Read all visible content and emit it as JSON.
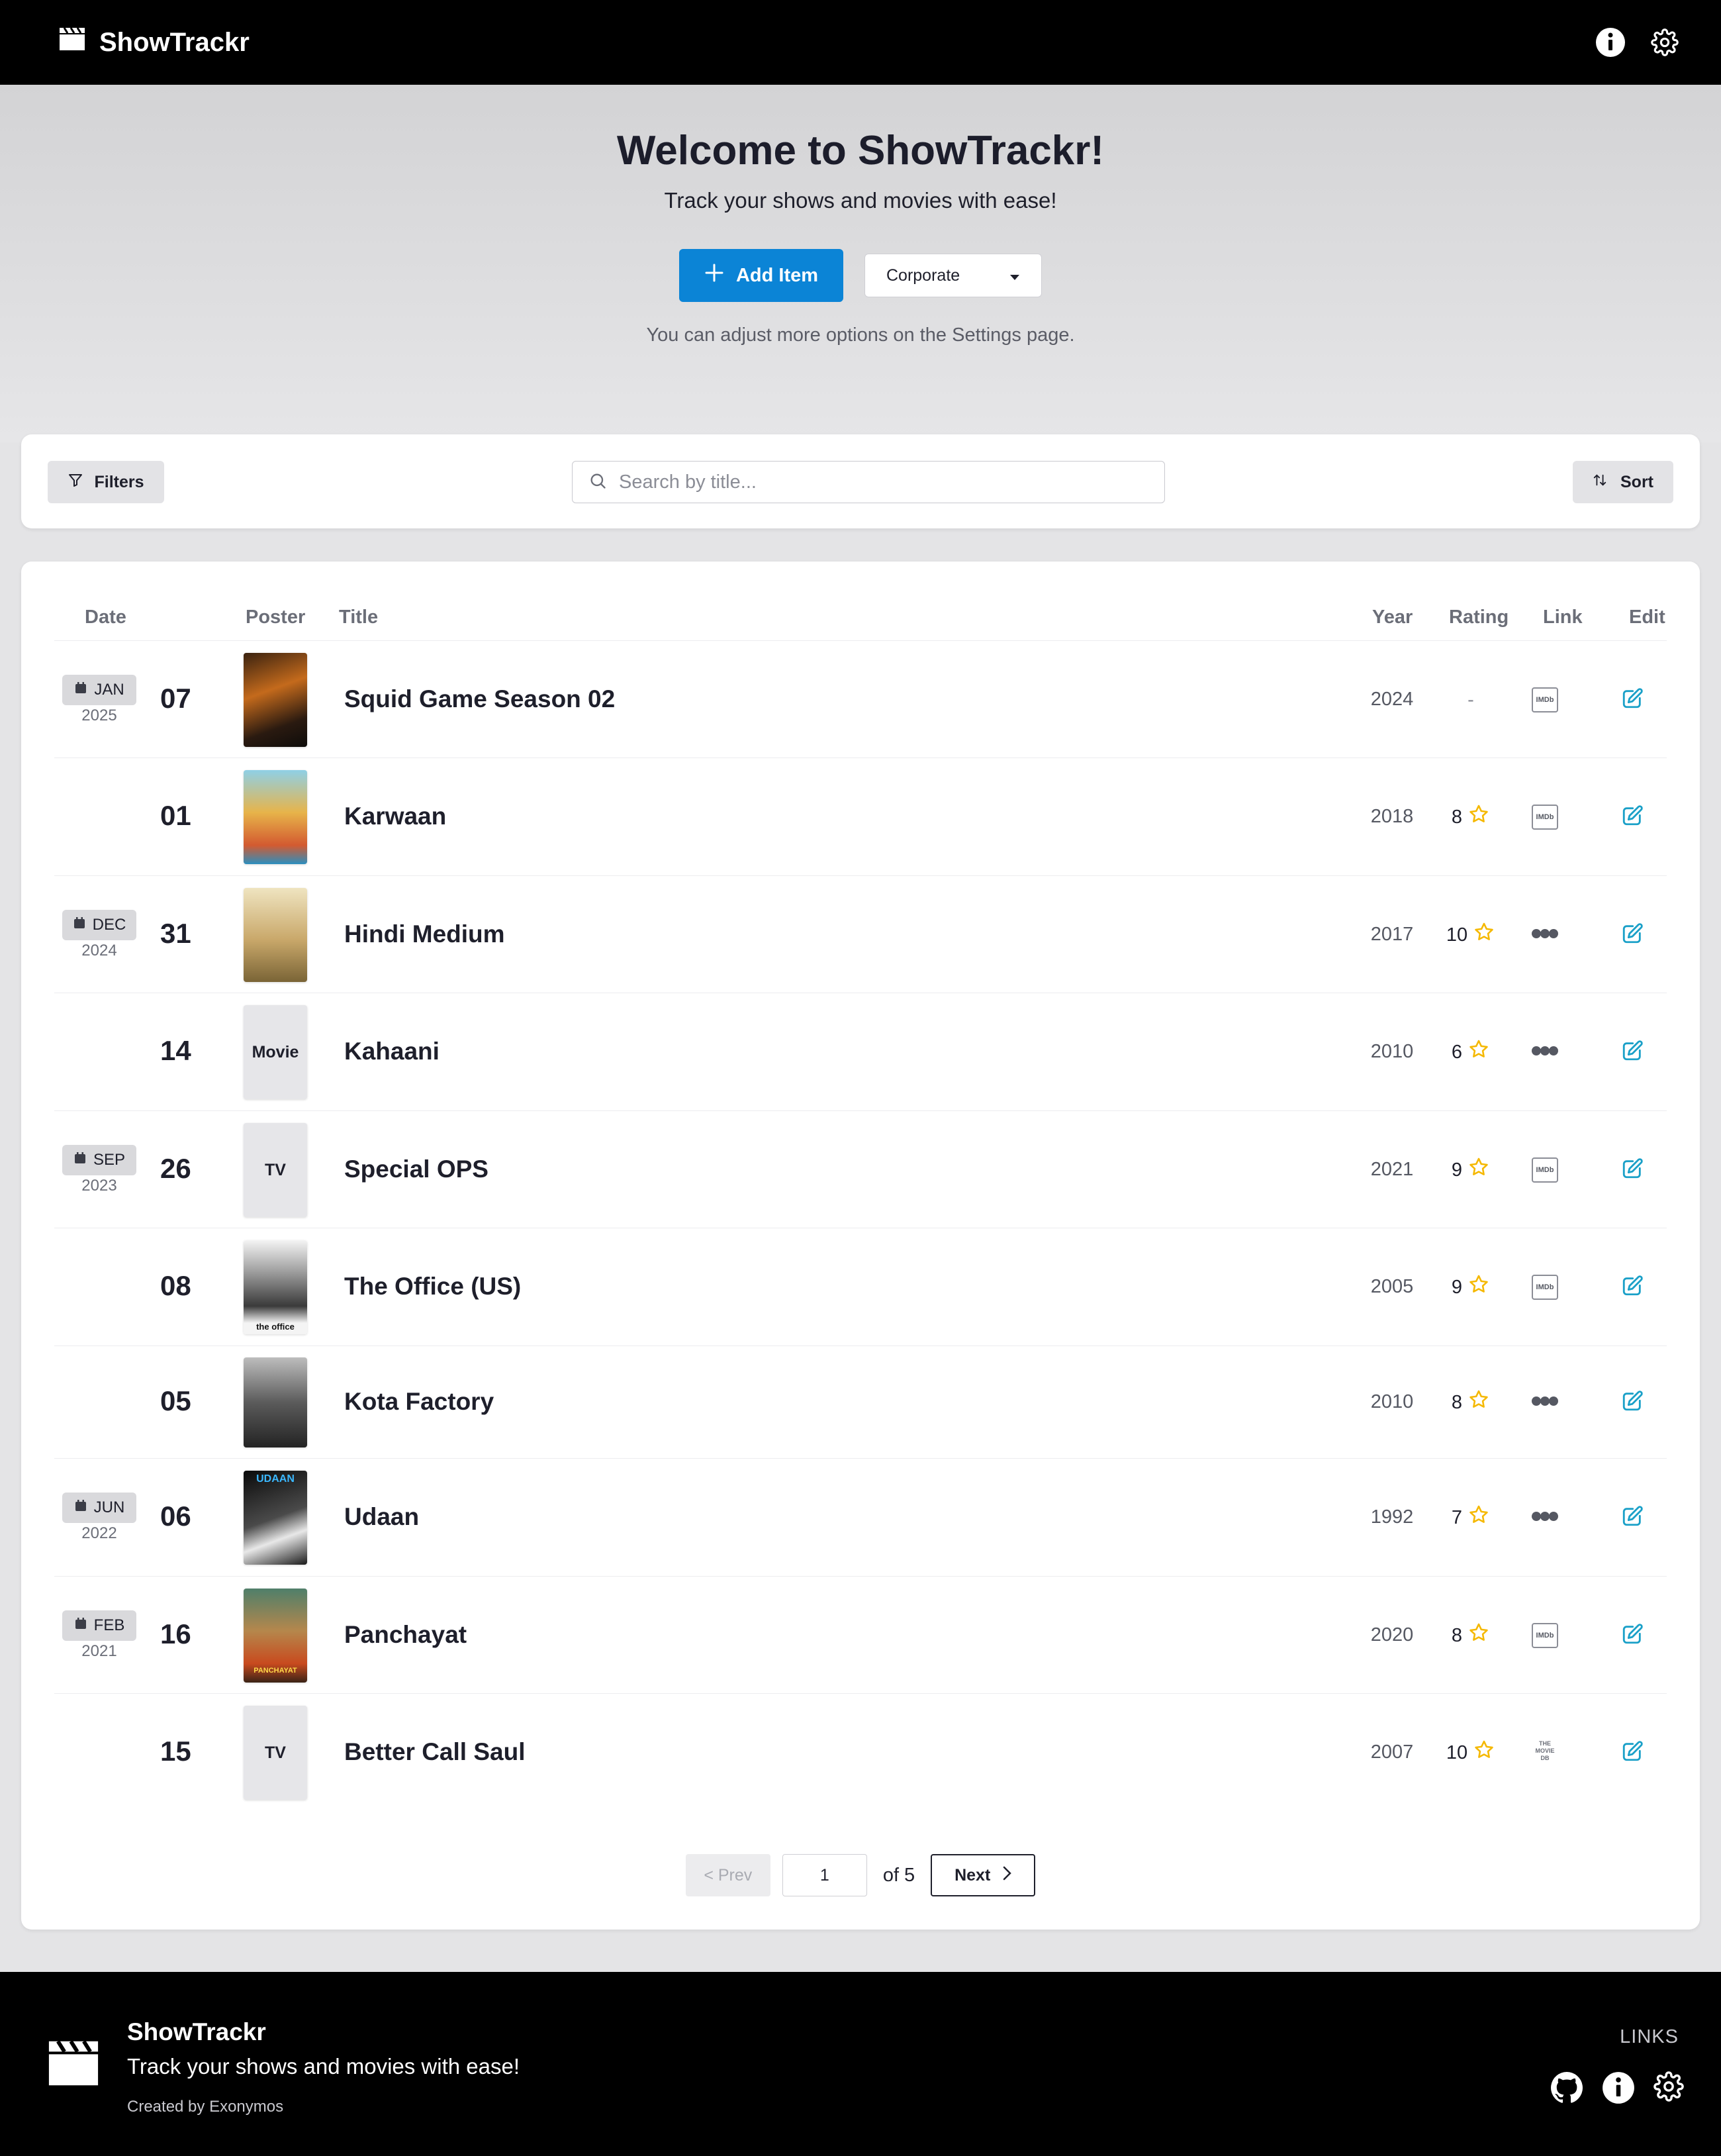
{
  "app": {
    "name": "ShowTrackr"
  },
  "hero": {
    "title": "Welcome to ShowTrackr!",
    "subtitle": "Track your shows and movies with ease!",
    "add_label": "Add Item",
    "theme_value": "Corporate",
    "hint": "You can adjust more options on the Settings page."
  },
  "toolbar": {
    "filters_label": "Filters",
    "search_placeholder": "Search by title...",
    "sort_label": "Sort"
  },
  "table": {
    "headers": {
      "date": "Date",
      "poster": "Poster",
      "title": "Title",
      "year": "Year",
      "rating": "Rating",
      "link": "Link",
      "edit": "Edit"
    },
    "rows": [
      {
        "month": "JAN",
        "date_year": "2025",
        "day": "07",
        "poster_label": "",
        "poster_kind": "squid",
        "title": "Squid Game Season 02",
        "year": "2024",
        "rating": "-",
        "link": "imdb"
      },
      {
        "month": "",
        "date_year": "",
        "day": "01",
        "poster_label": "",
        "poster_kind": "karwaan",
        "title": "Karwaan",
        "year": "2018",
        "rating": "8",
        "link": "imdb"
      },
      {
        "month": "DEC",
        "date_year": "2024",
        "day": "31",
        "poster_label": "",
        "poster_kind": "hindi",
        "title": "Hindi Medium",
        "year": "2017",
        "rating": "10",
        "link": "letterboxd"
      },
      {
        "month": "",
        "date_year": "",
        "day": "14",
        "poster_label": "Movie",
        "poster_kind": "placeholder",
        "title": "Kahaani",
        "year": "2010",
        "rating": "6",
        "link": "letterboxd"
      },
      {
        "month": "SEP",
        "date_year": "2023",
        "day": "26",
        "poster_label": "TV",
        "poster_kind": "placeholder",
        "title": "Special OPS",
        "year": "2021",
        "rating": "9",
        "link": "imdb"
      },
      {
        "month": "",
        "date_year": "",
        "day": "08",
        "poster_label": "the office",
        "poster_kind": "office",
        "title": "The Office (US)",
        "year": "2005",
        "rating": "9",
        "link": "imdb"
      },
      {
        "month": "",
        "date_year": "",
        "day": "05",
        "poster_label": "",
        "poster_kind": "kota",
        "title": "Kota Factory",
        "year": "2010",
        "rating": "8",
        "link": "letterboxd"
      },
      {
        "month": "JUN",
        "date_year": "2022",
        "day": "06",
        "poster_label": "UDAAN",
        "poster_kind": "udaan",
        "title": "Udaan",
        "year": "1992",
        "rating": "7",
        "link": "letterboxd"
      },
      {
        "month": "FEB",
        "date_year": "2021",
        "day": "16",
        "poster_label": "PANCHAYAT",
        "poster_kind": "panchayat",
        "title": "Panchayat",
        "year": "2020",
        "rating": "8",
        "link": "imdb"
      },
      {
        "month": "",
        "date_year": "",
        "day": "15",
        "poster_label": "TV",
        "poster_kind": "placeholder",
        "title": "Better Call Saul",
        "year": "2007",
        "rating": "10",
        "link": "tmdb"
      }
    ]
  },
  "link_badges": {
    "imdb": "IMDb",
    "tmdb": "THE MOVIE DB"
  },
  "pagination": {
    "prev_label": "< Prev",
    "page": "1",
    "of_label": "of 5",
    "next_label": "Next"
  },
  "footer": {
    "brand": "ShowTrackr",
    "tagline": "Track your shows and movies with ease!",
    "credit": "Created by Exonymos",
    "links_heading": "LINKS"
  },
  "colors": {
    "accent": "#0b84d6",
    "star": "#f5b800",
    "edit": "#1aa0c8",
    "nav_bg": "#000000"
  }
}
